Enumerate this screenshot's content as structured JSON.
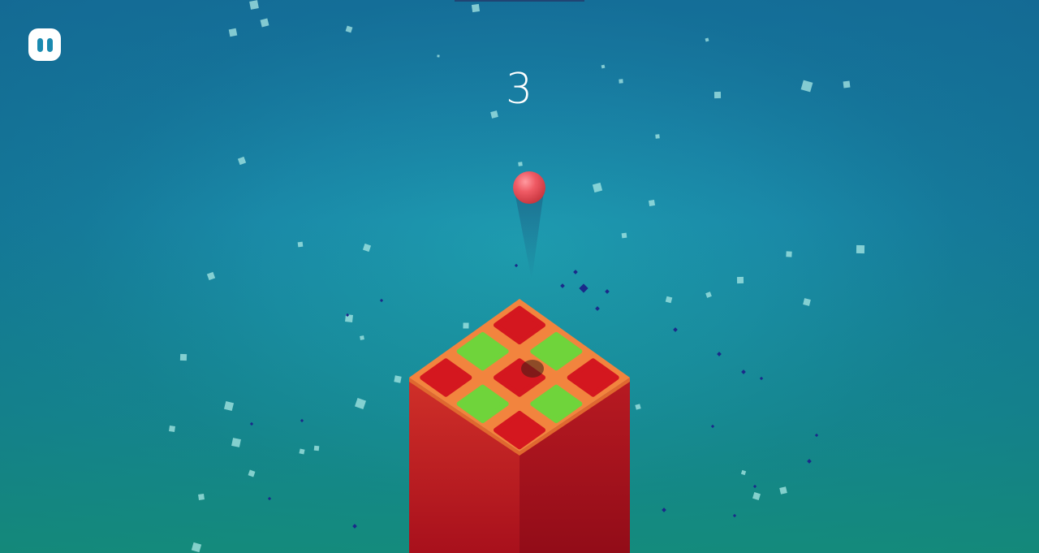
{
  "hud": {
    "score": "3"
  },
  "pause_button": {
    "icon": "pause-icon"
  },
  "board": {
    "rows": [
      [
        "red",
        "green",
        "red"
      ],
      [
        "green",
        "red",
        "green"
      ],
      [
        "red",
        "green",
        "red"
      ]
    ]
  },
  "colors": {
    "background_top": "#1a8aa8",
    "background_bottom": "#17997e",
    "tile_red": "#d4171f",
    "tile_green": "#6fd43b",
    "top_surface": "#f0803c",
    "pillar_front_left": "#c51f25",
    "pillar_front_right": "#b01a20",
    "ball": "#ee5560",
    "particle_light": "#a8e8e4",
    "particle_dark": "#1a2a8a"
  }
}
